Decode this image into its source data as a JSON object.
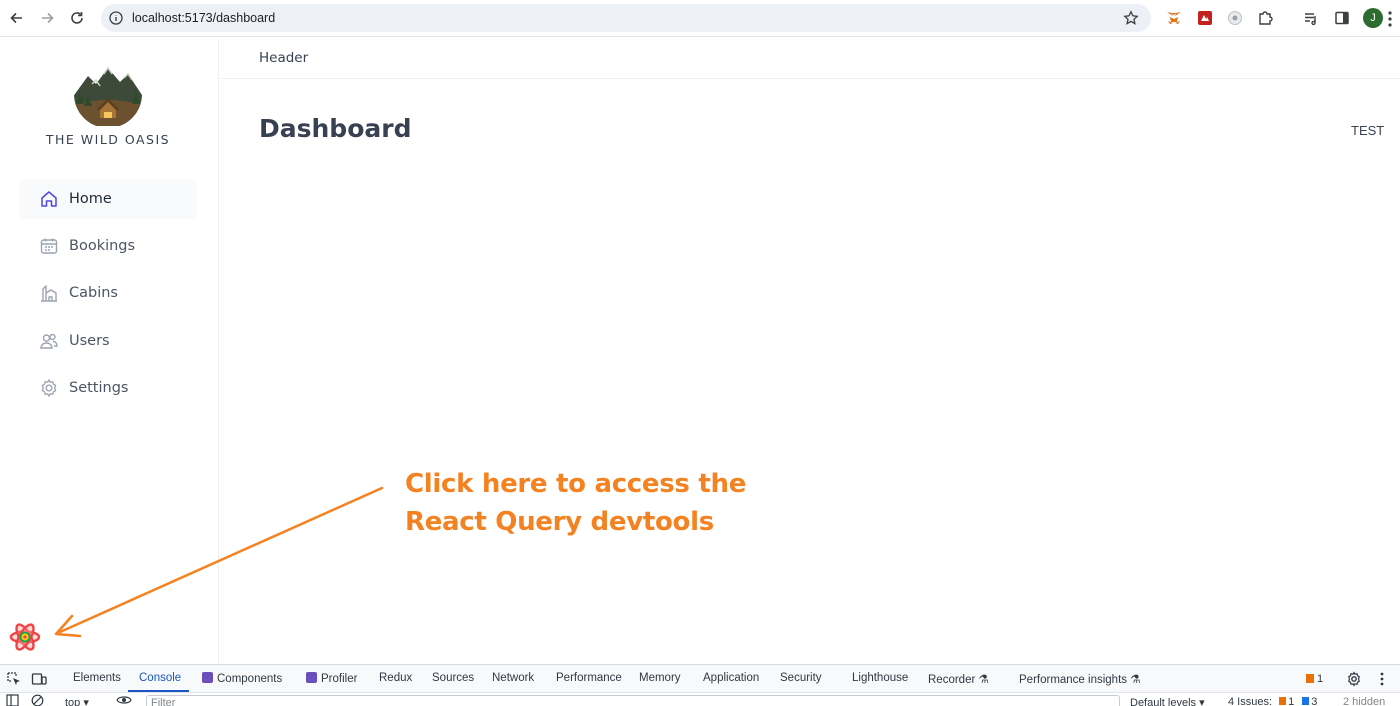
{
  "browser": {
    "url": "localhost:5173/dashboard",
    "profile_initial": "J",
    "icons": [
      "back-icon",
      "forward-icon",
      "reload-icon",
      "site-info-icon",
      "bookmark-star-icon",
      "metamask-extension-icon",
      "red-extension-icon",
      "grey-extension-icon",
      "extensions-puzzle-icon",
      "reading-list-icon",
      "side-panel-icon",
      "menu-kebab-icon"
    ]
  },
  "app": {
    "brand": "THE WILD OASIS",
    "header_text": "Header",
    "page_title": "Dashboard",
    "test_label": "TEST",
    "nav": [
      {
        "label": "Home",
        "icon": "home-icon",
        "active": true
      },
      {
        "label": "Bookings",
        "icon": "calendar-icon",
        "active": false
      },
      {
        "label": "Cabins",
        "icon": "cabins-icon",
        "active": false
      },
      {
        "label": "Users",
        "icon": "users-icon",
        "active": false
      },
      {
        "label": "Settings",
        "icon": "settings-icon",
        "active": false
      }
    ]
  },
  "annotation": {
    "line1": "Click here to access the",
    "line2": "React Query devtools",
    "color": "#f58220"
  },
  "devtools": {
    "tabs": [
      "Elements",
      "Console",
      "Components",
      "Profiler",
      "Redux",
      "Sources",
      "Network",
      "Performance",
      "Memory",
      "Application",
      "Security",
      "Lighthouse",
      "Recorder",
      "Performance insights"
    ],
    "active_tab": "Console",
    "issue_count": "1",
    "console": {
      "context": "top",
      "filter_placeholder": "Filter",
      "levels": "Default levels",
      "issues_label": "4 Issues:",
      "issues_warn": "1",
      "issues_info": "3",
      "hidden": "2 hidden"
    }
  },
  "colors": {
    "accent_blue": "#4f46e5",
    "devtools_active": "#1a56c4",
    "rq_logo": "#ef4444"
  }
}
